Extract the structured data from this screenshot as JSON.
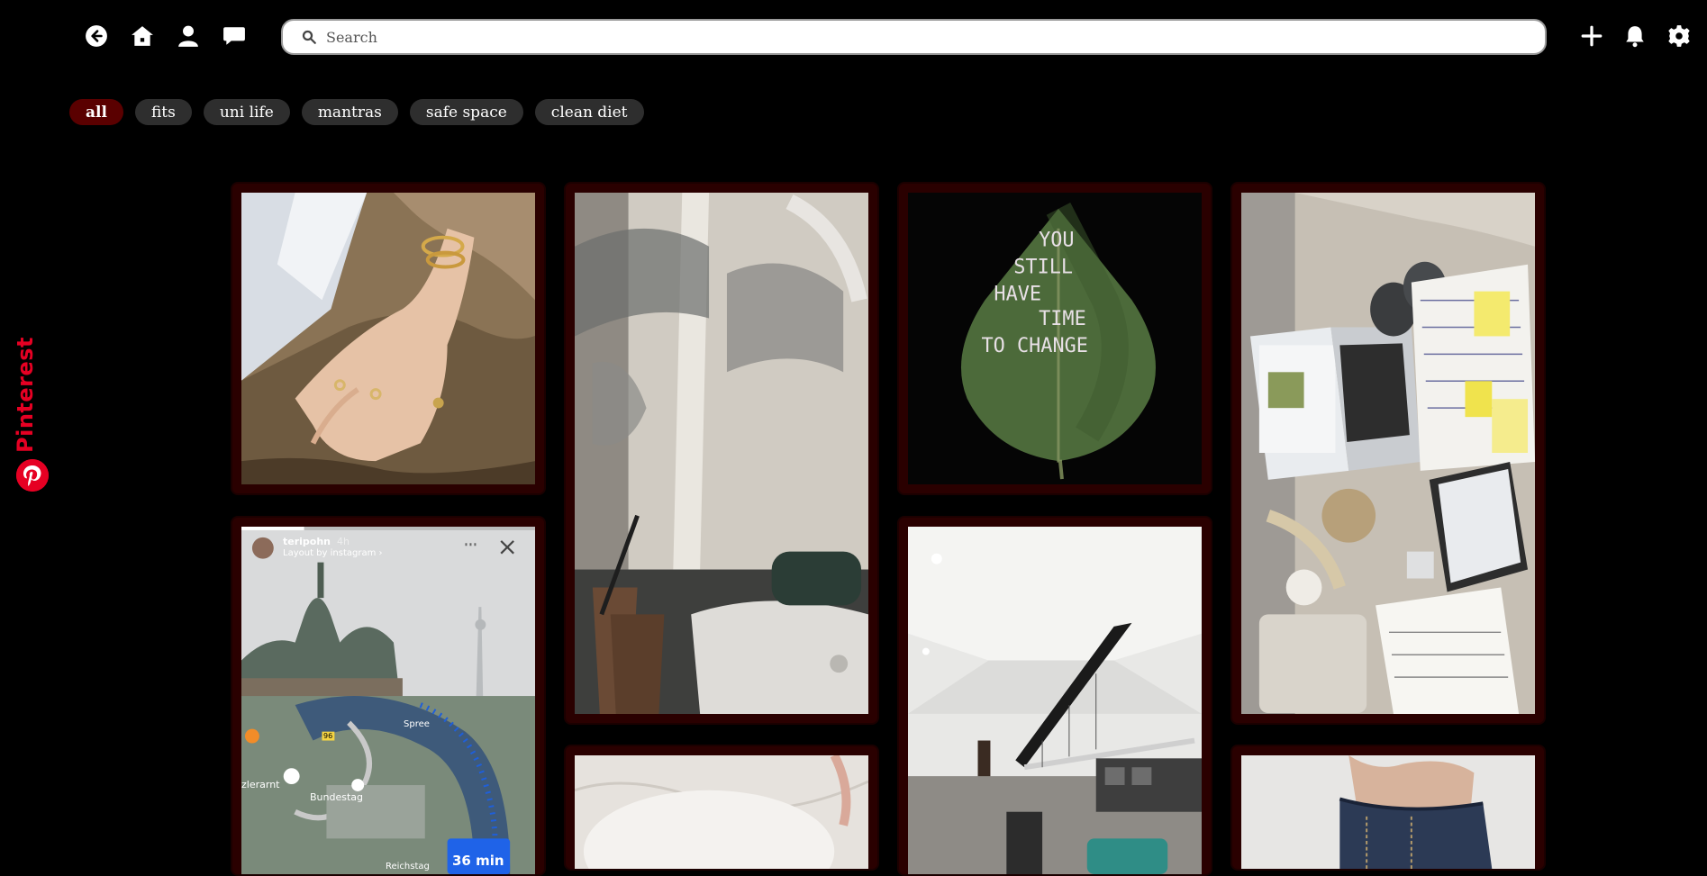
{
  "nav": {
    "back_icon": "arrow-left-circle-icon",
    "home_icon": "home-icon",
    "profile_icon": "user-icon",
    "messages_icon": "chat-bubble-icon",
    "create_icon": "plus-icon",
    "notifications_icon": "bell-icon",
    "settings_icon": "gear-icon"
  },
  "search": {
    "placeholder": "Search",
    "value": ""
  },
  "filters": [
    {
      "label": "all",
      "active": true
    },
    {
      "label": "fits",
      "active": false
    },
    {
      "label": "uni life",
      "active": false
    },
    {
      "label": "mantras",
      "active": false
    },
    {
      "label": "safe space",
      "active": false
    },
    {
      "label": "clean diet",
      "active": false
    }
  ],
  "brand": {
    "name": "Pinterest",
    "color": "#e60023"
  },
  "pins": [
    {
      "content": "hand-jewelry-photo"
    },
    {
      "content": "instagram-story-berlin-photo",
      "username": "teripohn",
      "age": "4h",
      "sub": "Layout by instagram ›",
      "map_badge": "36 min",
      "map_labels": [
        "Bundestag",
        "zlerarnt",
        "Reichstag",
        "Spree",
        "96"
      ]
    },
    {
      "content": "cafe-window-coffee-photo"
    },
    {
      "content": "marble-table-photo"
    },
    {
      "content": "leaf-quote-photo",
      "leaf_text": [
        "YOU",
        "STILL",
        "HAVE",
        "TIME",
        "TO CHANGE"
      ]
    },
    {
      "content": "interior-ceiling-photo"
    },
    {
      "content": "study-desk-laptop-photo"
    },
    {
      "content": "jeans-photo"
    }
  ],
  "colors": {
    "accent": "#5a0000",
    "pin_frame": "#2a0000",
    "chip": "#2e2e2e"
  }
}
